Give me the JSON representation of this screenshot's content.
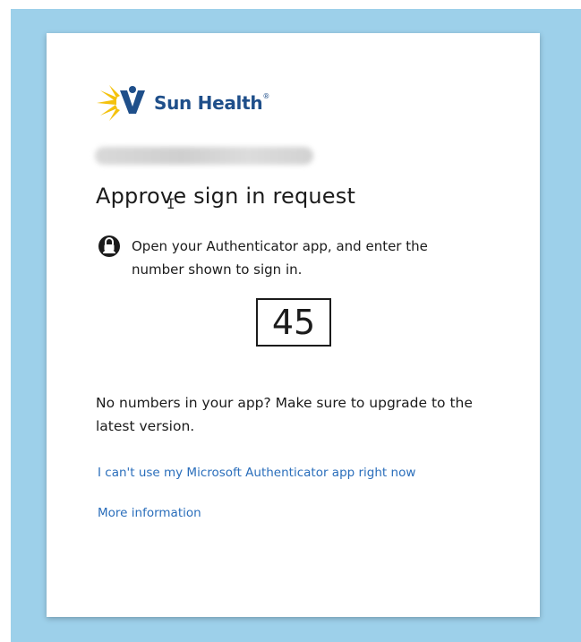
{
  "brand": {
    "name": "Sun Health",
    "trademark": "®",
    "logo_icon": "sun-figure-icon",
    "colors": {
      "sun": "#f4c20d",
      "figure": "#1f4f8a",
      "text": "#1f4f8a"
    }
  },
  "dialog": {
    "title": "Approve sign in request",
    "instruction_icon": "authenticator-lock-icon",
    "instruction": "Open your Authenticator app, and enter the number shown to sign in.",
    "number": "45",
    "no_numbers_text": "No numbers in your app? Make sure to upgrade to the latest version.",
    "links": {
      "cant_use": "I can't use my Microsoft Authenticator app right now",
      "more_info": "More information"
    }
  },
  "colors": {
    "backdrop": "#9dd0ea",
    "card": "#ffffff",
    "link": "#2a6ebb",
    "text": "#1b1b1b"
  }
}
